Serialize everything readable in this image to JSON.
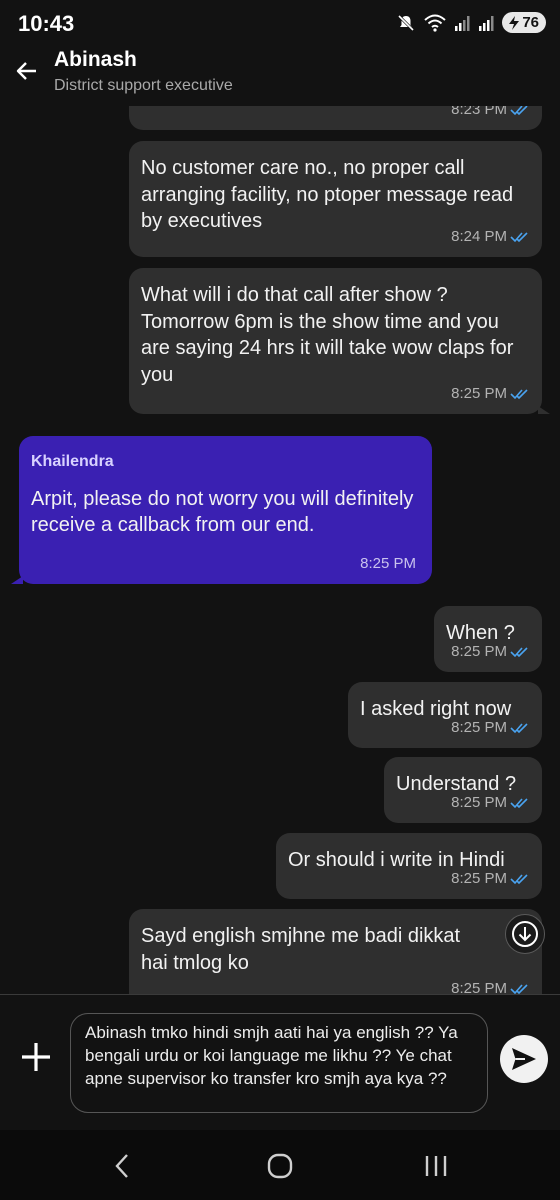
{
  "status_bar": {
    "time": "10:43",
    "battery": "76"
  },
  "header": {
    "name": "Abinash",
    "subtitle": "District support executive"
  },
  "messages": [
    {
      "id": "m0",
      "direction": "out",
      "text": "",
      "time": "8:23 PM"
    },
    {
      "id": "m1",
      "direction": "out",
      "text": "No customer care no., no proper call arranging facility, no ptoper message read by executives",
      "time": "8:24 PM"
    },
    {
      "id": "m2",
      "direction": "out",
      "text": "What will i do that call after show ? Tomorrow 6pm is the show time and you are saying 24 hrs it will take wow claps for you",
      "time": "8:25 PM"
    },
    {
      "id": "m3",
      "direction": "in",
      "sender": "Khailendra",
      "text": "Arpit, please do not worry you will definitely receive a callback from our end.",
      "time": "8:25 PM"
    },
    {
      "id": "m4",
      "direction": "out",
      "text": "When ?",
      "time": "8:25 PM"
    },
    {
      "id": "m5",
      "direction": "out",
      "text": "I asked right now",
      "time": "8:25 PM"
    },
    {
      "id": "m6",
      "direction": "out",
      "text": "Understand ?",
      "time": "8:25 PM"
    },
    {
      "id": "m7",
      "direction": "out",
      "text": "Or should i write in Hindi",
      "time": "8:25 PM"
    },
    {
      "id": "m8",
      "direction": "out",
      "text": "Sayd english smjhne me badi dikkat hai tmlog ko",
      "time": "8:25 PM"
    }
  ],
  "composer": {
    "text": "Abinash tmko hindi smjh aati hai ya english ?? Ya bengali urdu or koi language me likhu ?? Ye chat apne supervisor ko transfer kro smjh aya kya ??"
  },
  "icons": {
    "back": "arrow-left-icon",
    "read_receipt": "double-check-icon",
    "scroll_down": "arrow-down-circle-icon",
    "attach": "plus-icon",
    "send": "send-icon",
    "nav_back": "chevron-left-icon",
    "nav_home": "circle-icon",
    "nav_recents": "three-bars-icon"
  },
  "colors": {
    "outgoing_bubble": "#2f2f2f",
    "incoming_bubble": "#3a20b2",
    "read_tick": "#4aa3f0",
    "background": "#121212"
  }
}
